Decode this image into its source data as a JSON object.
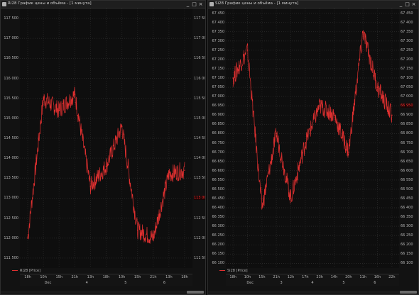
{
  "windows": [
    {
      "title": "RI28 График цены и объёма - [1 минута]",
      "legend": "RI28 [Price]",
      "buttons": {
        "minimize": "_",
        "maximize": "□",
        "close": "×"
      },
      "y_ticks": [
        "117 500",
        "117 000",
        "116 500",
        "116 000",
        "115 500",
        "115 000",
        "114 500",
        "114 000",
        "113 500",
        "113 000",
        "112 500",
        "112 000",
        "111 500"
      ],
      "current_price": "113 000",
      "x_ticks": [
        "18h",
        "10h",
        "15h",
        "21h",
        "13h",
        "18h",
        "10h",
        "15h",
        "21h",
        "13h",
        "18h"
      ],
      "x_days": [
        "Dec",
        "4",
        "5",
        "6"
      ],
      "chart_data": {
        "type": "line",
        "series_name": "RI28 [Price]",
        "x": [
          "18h",
          "10h",
          "15h",
          "21h",
          "13h",
          "18h",
          "10h",
          "15h",
          "21h",
          "13h",
          "18h"
        ],
        "values": [
          112000,
          115500,
          115200,
          115600,
          113300,
          113800,
          114800,
          112200,
          112000,
          113600,
          113700
        ],
        "ylim": [
          111250,
          117750
        ],
        "color": "#e03030"
      }
    },
    {
      "title": "Si28 График цены и объёма - [1 минута]",
      "legend": "Si28 [Price]",
      "buttons": {
        "minimize": "_",
        "maximize": "□",
        "close": "×"
      },
      "y_ticks": [
        "67 450",
        "67 400",
        "67 350",
        "67 300",
        "67 250",
        "67 200",
        "67 150",
        "67 100",
        "67 050",
        "67 000",
        "66 950",
        "66 900",
        "66 850",
        "66 800",
        "66 750",
        "66 700",
        "66 650",
        "66 600",
        "66 550",
        "66 500",
        "66 450",
        "66 400",
        "66 350",
        "66 300",
        "66 250",
        "66 200",
        "66 150",
        "66 100"
      ],
      "current_price": "66 950",
      "x_ticks": [
        "18h",
        "10h",
        "15h",
        "21h",
        "12h",
        "17h",
        "23h",
        "14h",
        "20h",
        "11h",
        "16h",
        "22h"
      ],
      "x_days": [
        "Dec",
        "3",
        "4",
        "5",
        "6"
      ],
      "chart_data": {
        "type": "line",
        "series_name": "Si28 [Price]",
        "x": [
          "18h",
          "10h",
          "15h",
          "21h",
          "12h",
          "17h",
          "23h",
          "14h",
          "20h",
          "11h",
          "16h",
          "22h"
        ],
        "values": [
          67100,
          67250,
          66400,
          66800,
          66450,
          66750,
          66950,
          66900,
          66700,
          67350,
          67050,
          66900
        ],
        "ylim": [
          66075,
          67475
        ],
        "color": "#e03030"
      }
    }
  ],
  "colors": {
    "background": "#121212",
    "series": "#e03030",
    "price_marker": "#ff3030",
    "text": "#b5b5b5"
  }
}
